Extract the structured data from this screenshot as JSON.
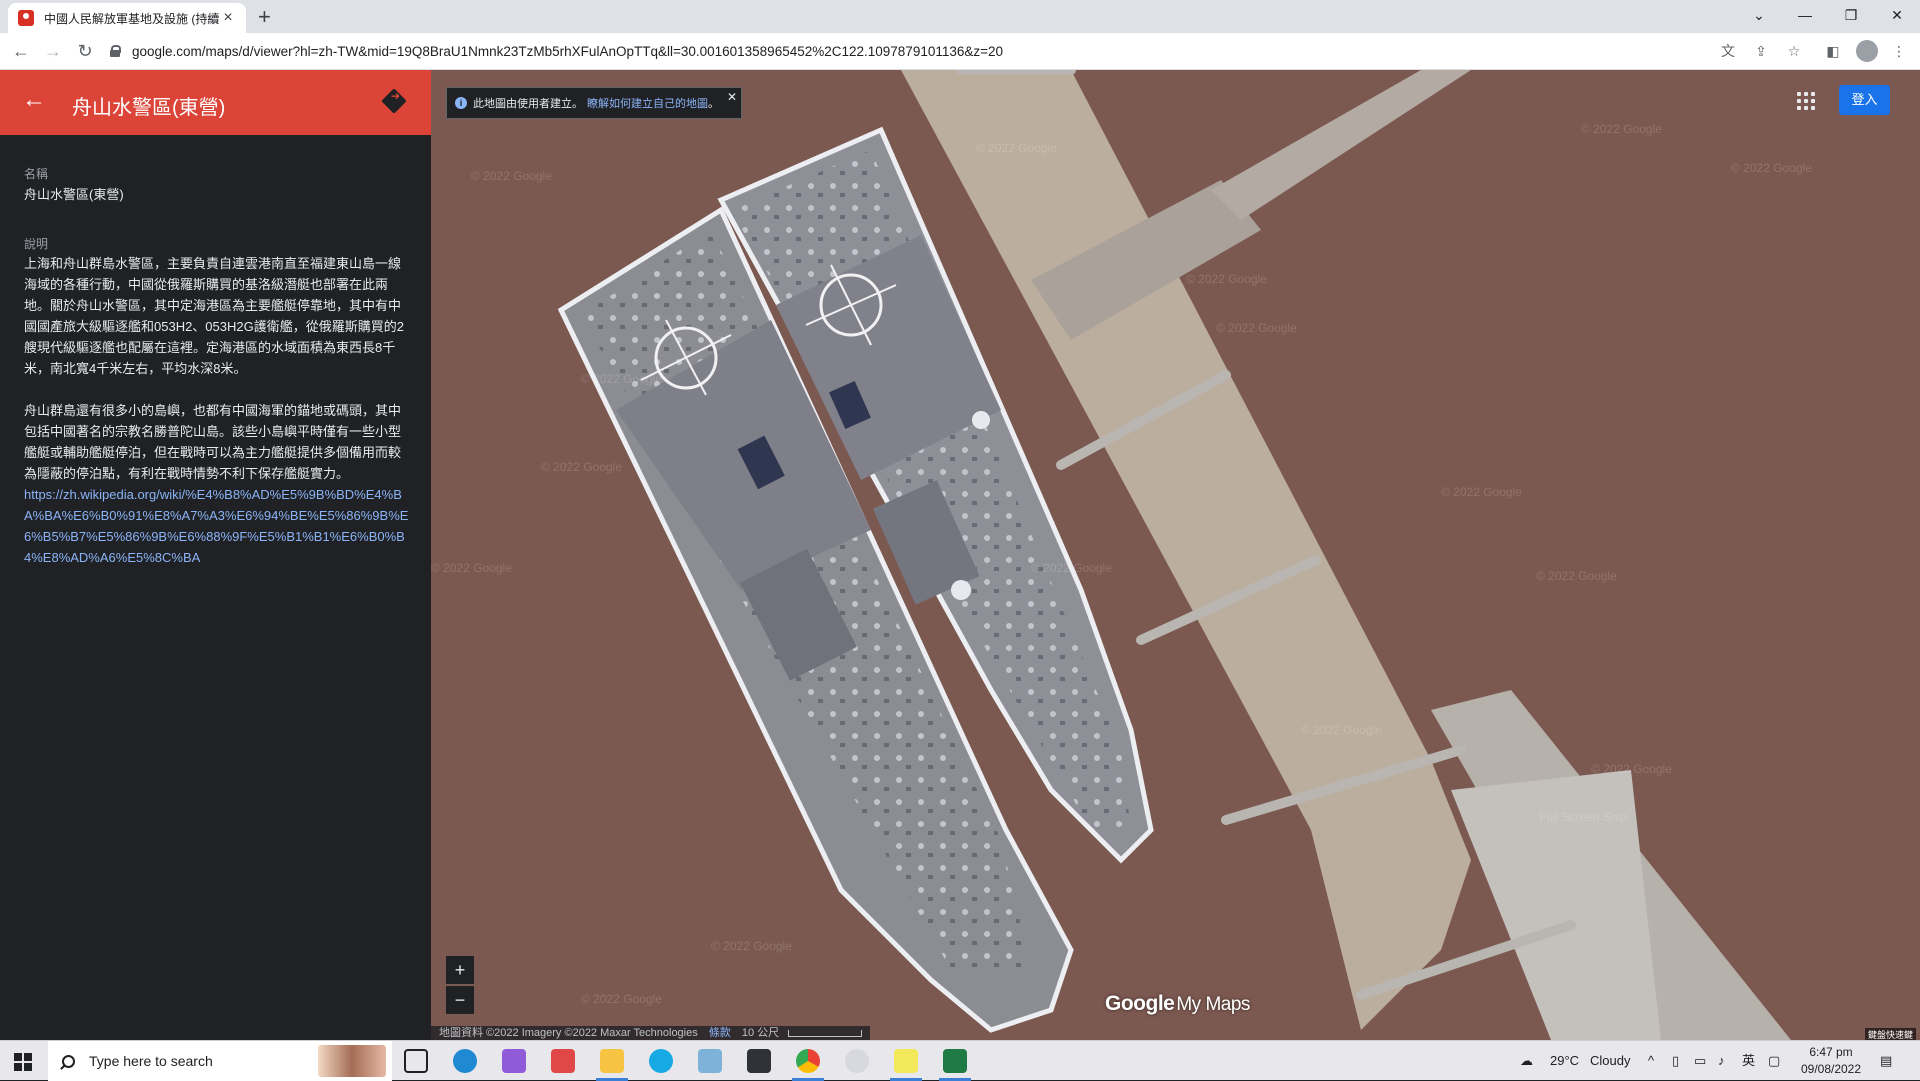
{
  "browser": {
    "tab_title": "中國人民解放軍基地及設施 (持續…",
    "url": "google.com/maps/d/viewer?hl=zh-TW&mid=19Q8BraU1Nmnk23TzMb5rhXFulAnOpTTq&ll=30.001601358965452%2C122.1097879101136&z=20",
    "window_controls": [
      "chevron-down-icon",
      "minimize-icon",
      "restore-icon",
      "close-icon"
    ]
  },
  "panel": {
    "title": "舟山水警區(東營)",
    "name_label": "名稱",
    "name_value": "舟山水警區(東營)",
    "description_label": "說明",
    "paragraph1": "上海和舟山群島水警區，主要負責自連雲港南直至福建東山島一線海域的各種行動，中國從俄羅斯購買的基洛級潛艇也部署在此兩地。關於舟山水警區，其中定海港區為主要艦艇停靠地，其中有中國國產旅大級驅逐艦和053H2、053H2G護衛艦，從俄羅斯購買的2艘現代級驅逐艦也配屬在這裡。定海港區的水域面積為東西長8千米，南北寬4千米左右，平均水深8米。",
    "paragraph2": "舟山群島還有很多小的島嶼，也都有中國海軍的錨地或碼頭，其中包括中國著名的宗教名勝普陀山島。該些小島嶼平時僅有一些小型艦艇或輔助艦艇停泊，但在戰時可以為主力艦艇提供多個備用而較為隱蔽的停泊點，有利在戰時情勢不利下保存艦艇實力。",
    "link": "https://zh.wikipedia.org/wiki/%E4%B8%AD%E5%9B%BD%E4%BA%BA%E6%B0%91%E8%A7%A3%E6%94%BE%E5%86%9B%E6%B5%B7%E5%86%9B%E6%88%9F%E5%B1%B1%E6%B0%B4%E8%AD%A6%E5%8C%BA"
  },
  "map": {
    "notice_text": "此地圖由使用者建立。",
    "notice_link": "瞭解如何建立自己的地圖",
    "notice_suffix": "。",
    "signin": "登入",
    "zoom_in": "+",
    "zoom_out": "−",
    "logo_google": "Google",
    "logo_mymaps": "My Maps",
    "attribution": "地圖資料 ©2022 Imagery ©2022 Maxar Technologies",
    "terms": "條款",
    "scale": "10 公尺",
    "shortcut": "鍵盤快速鍵",
    "watermark": "© 2022 Google",
    "watermark_extra": "Full Screen Snip",
    "colors": {
      "water": "#7b5850",
      "pier": "#bcae9f",
      "ship_deck": "#8c8c93",
      "header": "#db4437"
    }
  },
  "taskbar": {
    "search_placeholder": "Type here to search",
    "weather_temp": "29°C",
    "weather_text": "Cloudy",
    "ime": "英",
    "time": "6:47 pm",
    "date": "09/08/2022"
  }
}
